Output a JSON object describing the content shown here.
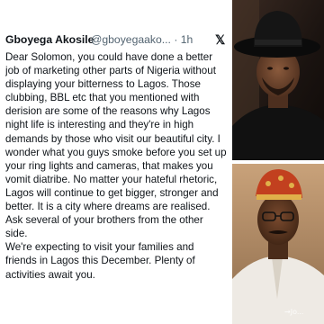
{
  "tweet": {
    "author_name": "Gboyega Akosile",
    "author_handle": "@gboyegaako... · 1h",
    "x_icon": "x-logo-icon",
    "x_glyph": "𝕏",
    "lines": [
      "Dear Solomon, you could have done a better",
      "job of marketing other parts of Nigeria without",
      "displaying your bitterness to Lagos. Those",
      "clubbing, BBL etc that you mentioned with",
      "derision are some of the reasons why Lagos",
      "night life is interesting and they're in high",
      "demands by those who visit our beautiful city. I",
      "wonder what you guys smoke before you set up",
      "your ring lights and cameras, that makes you",
      "vomit diatribe. No matter your hateful rhetoric,",
      "Lagos will continue to get bigger, stronger and",
      "better. It is a city where dreams are realised.",
      "Ask several of your brothers from the other",
      "side.",
      "We're expecting to visit your families and",
      "friends in Lagos this December. Plenty of",
      "activities await you."
    ]
  },
  "photos": {
    "top_alt": "man-in-black-hat-photo",
    "bottom_alt": "man-in-embroidered-cap-photo",
    "watermark": "→Jo..."
  },
  "colors": {
    "text": "#0f1419",
    "secondary_text": "#536471"
  }
}
